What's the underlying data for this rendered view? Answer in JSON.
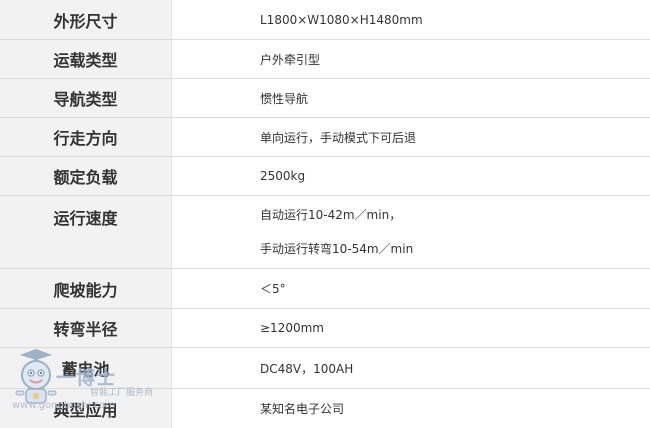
{
  "specs": [
    {
      "label": "外形尺寸",
      "value": "L1800×W1080×H1480mm"
    },
    {
      "label": "运载类型",
      "value": "户外牵引型"
    },
    {
      "label": "导航类型",
      "value": "惯性导航"
    },
    {
      "label": "行走方向",
      "value": "单向运行，手动模式下可后退"
    },
    {
      "label": "额定负载",
      "value": "2500kg"
    },
    {
      "label": "运行速度",
      "value_line1": "自动运行10-42m／min，",
      "value_line2": "手动运行转弯10-54m／min"
    },
    {
      "label": "爬坡能力",
      "value": "＜5°"
    },
    {
      "label": "转弯半径",
      "value": "≥1200mm"
    },
    {
      "label": "蓄电池",
      "value": "DC48V，100AH"
    },
    {
      "label": "典型应用",
      "value": "某知名电子公司"
    }
  ],
  "watermark": {
    "brand": "一博士",
    "tagline": "智能工厂服务商",
    "url": "www.gongboshi.com"
  },
  "colors": {
    "label_bg": "#f2f2f2",
    "border": "#dcdcdc",
    "text": "#333333"
  }
}
